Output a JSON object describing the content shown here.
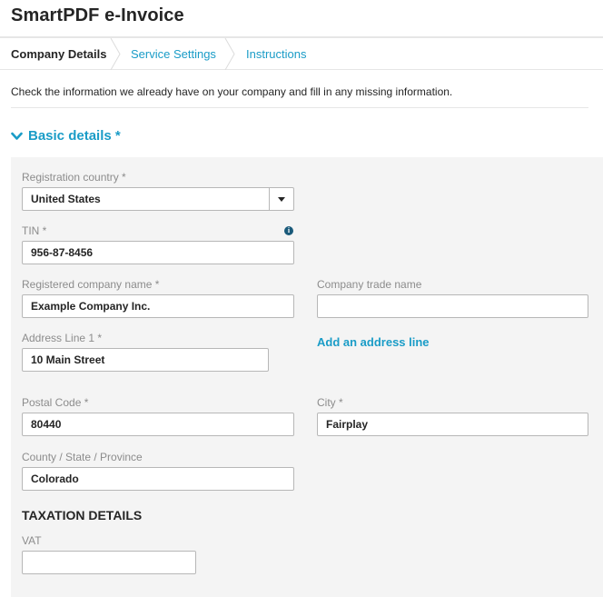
{
  "app": {
    "title": "SmartPDF e-Invoice"
  },
  "tabs": [
    {
      "label": "Company Details",
      "active": true
    },
    {
      "label": "Service Settings",
      "active": false
    },
    {
      "label": "Instructions",
      "active": false
    }
  ],
  "intro": "Check the information we already have on your company and fill in any missing information.",
  "section": {
    "title": "Basic details *",
    "icon": "chevron-down-icon"
  },
  "form": {
    "registration_country": {
      "label": "Registration country *",
      "value": "United States"
    },
    "tin": {
      "label": "TIN *",
      "value": "956-87-8456",
      "info_icon": "info-icon"
    },
    "registered_company_name": {
      "label": "Registered company name *",
      "value": "Example Company Inc."
    },
    "company_trade_name": {
      "label": "Company trade name",
      "value": ""
    },
    "address_line_1": {
      "label": "Address Line 1 *",
      "value": "10 Main Street"
    },
    "add_address_line": "Add an address line",
    "postal_code": {
      "label": "Postal Code *",
      "value": "80440"
    },
    "city": {
      "label": "City *",
      "value": "Fairplay"
    },
    "county_state_province": {
      "label": "County / State / Province",
      "value": "Colorado"
    },
    "taxation_heading": "TAXATION DETAILS",
    "vat": {
      "label": "VAT",
      "value": ""
    }
  },
  "colors": {
    "accent": "#1a9cc7",
    "text": "#252525",
    "label": "#8c8c8c",
    "panel_bg": "#f4f4f4",
    "border": "#b7b7b7"
  }
}
